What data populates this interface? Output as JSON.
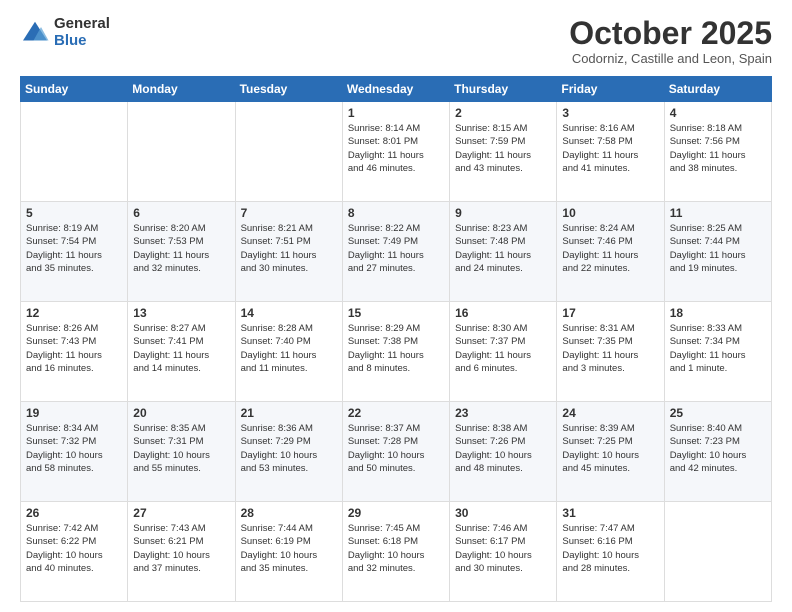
{
  "header": {
    "logo_general": "General",
    "logo_blue": "Blue",
    "month": "October 2025",
    "location": "Codorniz, Castille and Leon, Spain"
  },
  "days_of_week": [
    "Sunday",
    "Monday",
    "Tuesday",
    "Wednesday",
    "Thursday",
    "Friday",
    "Saturday"
  ],
  "weeks": [
    [
      {
        "day": "",
        "text": ""
      },
      {
        "day": "",
        "text": ""
      },
      {
        "day": "",
        "text": ""
      },
      {
        "day": "1",
        "text": "Sunrise: 8:14 AM\nSunset: 8:01 PM\nDaylight: 11 hours\nand 46 minutes."
      },
      {
        "day": "2",
        "text": "Sunrise: 8:15 AM\nSunset: 7:59 PM\nDaylight: 11 hours\nand 43 minutes."
      },
      {
        "day": "3",
        "text": "Sunrise: 8:16 AM\nSunset: 7:58 PM\nDaylight: 11 hours\nand 41 minutes."
      },
      {
        "day": "4",
        "text": "Sunrise: 8:18 AM\nSunset: 7:56 PM\nDaylight: 11 hours\nand 38 minutes."
      }
    ],
    [
      {
        "day": "5",
        "text": "Sunrise: 8:19 AM\nSunset: 7:54 PM\nDaylight: 11 hours\nand 35 minutes."
      },
      {
        "day": "6",
        "text": "Sunrise: 8:20 AM\nSunset: 7:53 PM\nDaylight: 11 hours\nand 32 minutes."
      },
      {
        "day": "7",
        "text": "Sunrise: 8:21 AM\nSunset: 7:51 PM\nDaylight: 11 hours\nand 30 minutes."
      },
      {
        "day": "8",
        "text": "Sunrise: 8:22 AM\nSunset: 7:49 PM\nDaylight: 11 hours\nand 27 minutes."
      },
      {
        "day": "9",
        "text": "Sunrise: 8:23 AM\nSunset: 7:48 PM\nDaylight: 11 hours\nand 24 minutes."
      },
      {
        "day": "10",
        "text": "Sunrise: 8:24 AM\nSunset: 7:46 PM\nDaylight: 11 hours\nand 22 minutes."
      },
      {
        "day": "11",
        "text": "Sunrise: 8:25 AM\nSunset: 7:44 PM\nDaylight: 11 hours\nand 19 minutes."
      }
    ],
    [
      {
        "day": "12",
        "text": "Sunrise: 8:26 AM\nSunset: 7:43 PM\nDaylight: 11 hours\nand 16 minutes."
      },
      {
        "day": "13",
        "text": "Sunrise: 8:27 AM\nSunset: 7:41 PM\nDaylight: 11 hours\nand 14 minutes."
      },
      {
        "day": "14",
        "text": "Sunrise: 8:28 AM\nSunset: 7:40 PM\nDaylight: 11 hours\nand 11 minutes."
      },
      {
        "day": "15",
        "text": "Sunrise: 8:29 AM\nSunset: 7:38 PM\nDaylight: 11 hours\nand 8 minutes."
      },
      {
        "day": "16",
        "text": "Sunrise: 8:30 AM\nSunset: 7:37 PM\nDaylight: 11 hours\nand 6 minutes."
      },
      {
        "day": "17",
        "text": "Sunrise: 8:31 AM\nSunset: 7:35 PM\nDaylight: 11 hours\nand 3 minutes."
      },
      {
        "day": "18",
        "text": "Sunrise: 8:33 AM\nSunset: 7:34 PM\nDaylight: 11 hours\nand 1 minute."
      }
    ],
    [
      {
        "day": "19",
        "text": "Sunrise: 8:34 AM\nSunset: 7:32 PM\nDaylight: 10 hours\nand 58 minutes."
      },
      {
        "day": "20",
        "text": "Sunrise: 8:35 AM\nSunset: 7:31 PM\nDaylight: 10 hours\nand 55 minutes."
      },
      {
        "day": "21",
        "text": "Sunrise: 8:36 AM\nSunset: 7:29 PM\nDaylight: 10 hours\nand 53 minutes."
      },
      {
        "day": "22",
        "text": "Sunrise: 8:37 AM\nSunset: 7:28 PM\nDaylight: 10 hours\nand 50 minutes."
      },
      {
        "day": "23",
        "text": "Sunrise: 8:38 AM\nSunset: 7:26 PM\nDaylight: 10 hours\nand 48 minutes."
      },
      {
        "day": "24",
        "text": "Sunrise: 8:39 AM\nSunset: 7:25 PM\nDaylight: 10 hours\nand 45 minutes."
      },
      {
        "day": "25",
        "text": "Sunrise: 8:40 AM\nSunset: 7:23 PM\nDaylight: 10 hours\nand 42 minutes."
      }
    ],
    [
      {
        "day": "26",
        "text": "Sunrise: 7:42 AM\nSunset: 6:22 PM\nDaylight: 10 hours\nand 40 minutes."
      },
      {
        "day": "27",
        "text": "Sunrise: 7:43 AM\nSunset: 6:21 PM\nDaylight: 10 hours\nand 37 minutes."
      },
      {
        "day": "28",
        "text": "Sunrise: 7:44 AM\nSunset: 6:19 PM\nDaylight: 10 hours\nand 35 minutes."
      },
      {
        "day": "29",
        "text": "Sunrise: 7:45 AM\nSunset: 6:18 PM\nDaylight: 10 hours\nand 32 minutes."
      },
      {
        "day": "30",
        "text": "Sunrise: 7:46 AM\nSunset: 6:17 PM\nDaylight: 10 hours\nand 30 minutes."
      },
      {
        "day": "31",
        "text": "Sunrise: 7:47 AM\nSunset: 6:16 PM\nDaylight: 10 hours\nand 28 minutes."
      },
      {
        "day": "",
        "text": ""
      }
    ]
  ]
}
